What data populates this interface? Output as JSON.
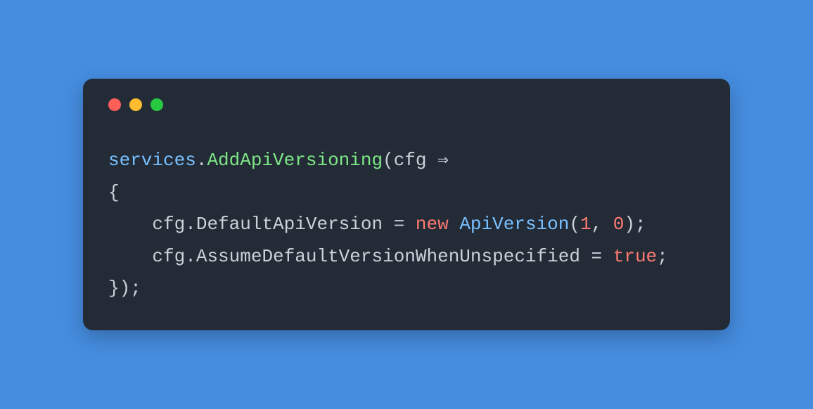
{
  "colors": {
    "background": "#468de0",
    "window_bg": "#232b36",
    "dot_red": "#ff5f57",
    "dot_yellow": "#febc2e",
    "dot_green": "#28c840"
  },
  "code": {
    "line1": {
      "obj": "services",
      "dot": ".",
      "method": "AddApiVersioning",
      "open_paren": "(",
      "param": "cfg",
      "arrow": " ⇒",
      "space": " "
    },
    "line2": {
      "open_brace": "{"
    },
    "line3": {
      "indent": "    ",
      "param": "cfg",
      "dot": ".",
      "prop": "DefaultApiVersion",
      "eq": " = ",
      "kw": "new",
      "space": " ",
      "type": "ApiVersion",
      "open_paren": "(",
      "num1": "1",
      "comma": ", ",
      "num2": "0",
      "close_paren": ")",
      "semi": ";"
    },
    "line4": {
      "indent": "    ",
      "param": "cfg",
      "dot": ".",
      "prop": "AssumeDefaultVersionWhenUnspecified",
      "eq": " = ",
      "bool": "true",
      "semi": ";"
    },
    "line5": {
      "close_brace": "}",
      "close_paren": ")",
      "semi": ";"
    }
  }
}
